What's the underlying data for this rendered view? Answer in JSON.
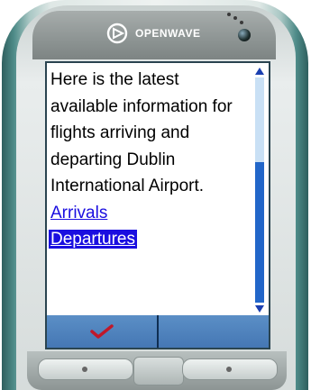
{
  "device": {
    "brand": "OPENWAVE"
  },
  "screen": {
    "paragraph": "Here is the latest available information for flights arriving and departing Dublin International Airport.",
    "links": [
      {
        "label": "Arrivals",
        "focused": false
      },
      {
        "label": "Departures",
        "focused": true
      }
    ]
  },
  "scrollbar": {
    "position_fraction": 1.0
  },
  "softkeys": {
    "left_icon": "checkmark-icon",
    "right_label": ""
  },
  "colors": {
    "link": "#1a0ee0",
    "softkey_bar": "#4f82bd",
    "checkmark": "#c0182a",
    "scroll_thumb": "#2266c9"
  }
}
